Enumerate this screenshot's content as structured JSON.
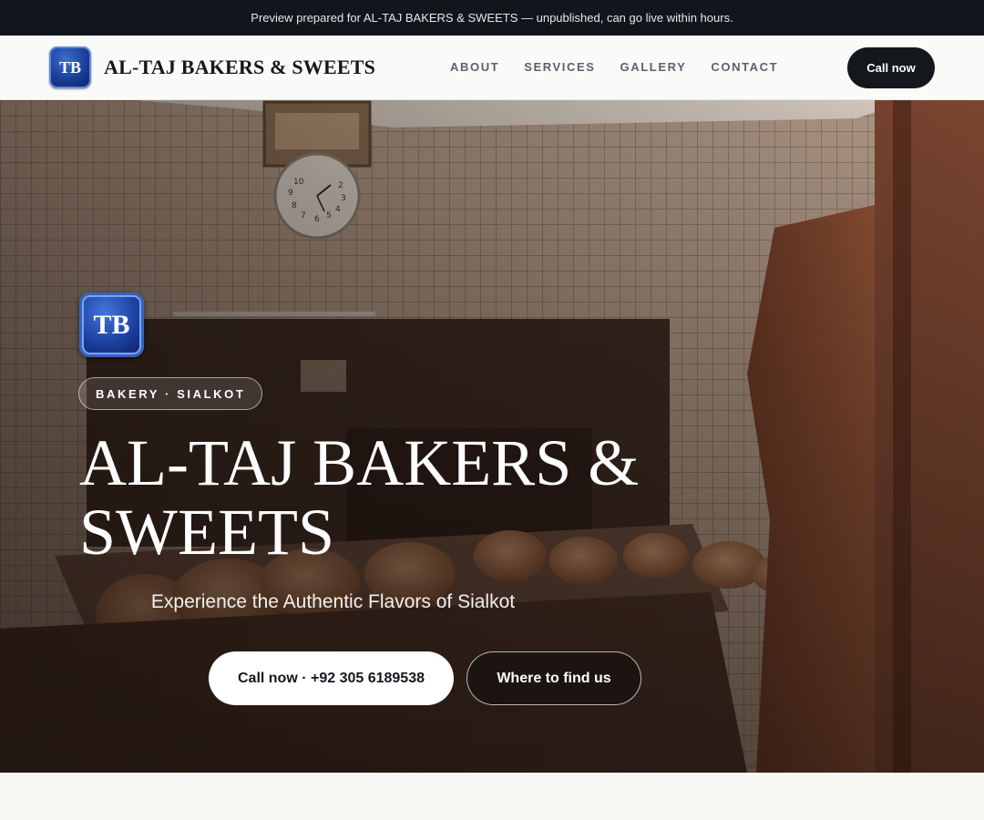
{
  "announcement": "Preview prepared for AL-TAJ BAKERS & SWEETS — unpublished, can go live within hours.",
  "header": {
    "logo_initials": "TB",
    "brand_name": "AL-TAJ BAKERS & SWEETS",
    "nav": [
      {
        "label": "ABOUT"
      },
      {
        "label": "SERVICES"
      },
      {
        "label": "GALLERY"
      },
      {
        "label": "CONTACT"
      }
    ],
    "cta_label": "Call now"
  },
  "hero": {
    "logo_initials": "TB",
    "badge": "BAKERY · SIALKOT",
    "title": "AL-TAJ BAKERS & SWEETS",
    "subtitle": "Experience the Authentic Flavors of Sialkot",
    "primary_button": "Call now · +92 305 6189538",
    "secondary_button": "Where to find us",
    "clock_numerals": [
      "10",
      "9",
      "8",
      "7",
      "6",
      "5",
      "2",
      "3",
      "4"
    ]
  },
  "colors": {
    "announcement_bg": "#12151b",
    "header_bg": "#fafaf8",
    "cta_bg": "#14171c",
    "logo_blue": "#1a3c96",
    "hero_text": "#ffffff"
  }
}
